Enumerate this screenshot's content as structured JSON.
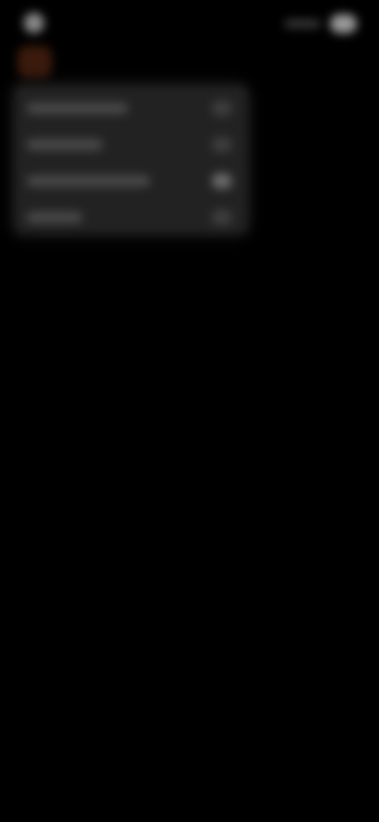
{
  "status_bar": {
    "icons": [
      "time-icon",
      "signal-icon",
      "battery-icon"
    ]
  },
  "app": {
    "icon": "app-logo-icon",
    "accent_color": "#3a1a0c"
  },
  "menu": {
    "background_color": "#222222",
    "items": [
      {
        "label": "",
        "badge_icon": "badge-icon"
      },
      {
        "label": "",
        "badge_icon": "badge-icon"
      },
      {
        "label": "",
        "badge_icon": "badge-icon"
      },
      {
        "label": "",
        "badge_icon": "badge-icon"
      }
    ]
  }
}
